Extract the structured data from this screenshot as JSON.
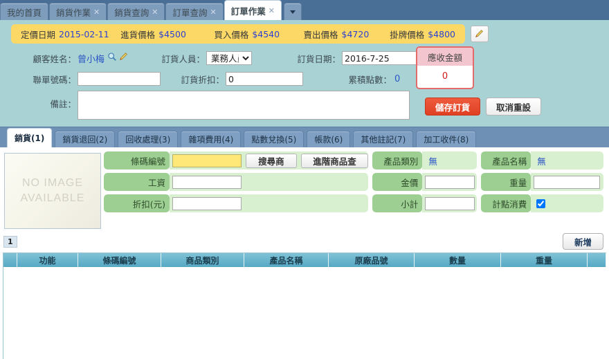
{
  "window_tabs": [
    {
      "label": "我的首頁",
      "closable": false,
      "active": false
    },
    {
      "label": "銷貨作業",
      "closable": true,
      "active": false
    },
    {
      "label": "銷貨查詢",
      "closable": true,
      "active": false
    },
    {
      "label": "訂單查詢",
      "closable": true,
      "active": false
    },
    {
      "label": "訂單作業",
      "closable": true,
      "active": true
    }
  ],
  "tab_overflow_icon": "chevron-down-icon",
  "price_bar": {
    "items": [
      {
        "label": "定價日期",
        "value": "2015-02-11"
      },
      {
        "label": "進貨價格",
        "value": "$4500"
      },
      {
        "label": "買入價格",
        "value": "$4540"
      },
      {
        "label": "賣出價格",
        "value": "$4720"
      },
      {
        "label": "掛牌價格",
        "value": "$4800"
      }
    ],
    "edit_icon": "pencil-icon"
  },
  "form": {
    "customer_label": "顧客姓名：",
    "customer_value": "曾小梅",
    "customer_search_icon": "magnifier-icon",
    "customer_edit_icon": "pencil-icon",
    "staff_label": "訂貨人員：",
    "staff_value": "業務人員",
    "staff_options": [
      "業務人員"
    ],
    "date_label": "訂貨日期：",
    "date_value": "2016-7-25",
    "order_no_label": "聯單號碼：",
    "order_no_value": "",
    "discount_label": "訂貨折扣：",
    "discount_value": "0",
    "points_label": "累積點數：",
    "points_value": "0",
    "remark_label": "備註：",
    "remark_value": "",
    "receivable_title": "應收金額",
    "receivable_value": "0",
    "save_label": "儲存訂貨",
    "cancel_label": "取消重設"
  },
  "section_tabs": [
    {
      "label": "銷貨(1)",
      "active": true
    },
    {
      "label": "銷貨退回(2)",
      "active": false
    },
    {
      "label": "回收處理(3)",
      "active": false
    },
    {
      "label": "雜項費用(4)",
      "active": false
    },
    {
      "label": "點數兌換(5)",
      "active": false
    },
    {
      "label": "帳款(6)",
      "active": false
    },
    {
      "label": "其他註記(7)",
      "active": false
    },
    {
      "label": "加工收件(8)",
      "active": false
    }
  ],
  "image_placeholder": {
    "line1": "NO IMAGE",
    "line2": "AVAILABLE"
  },
  "entry_panel": {
    "barcode_label": "條碼編號",
    "barcode_value": "",
    "search_product_label": "搜尋商品",
    "advanced_search_label": "進階商品查詢",
    "category_label": "產品類別",
    "category_value": "無",
    "product_name_label": "產品名稱",
    "product_name_value": "無",
    "wage_label": "工資",
    "wage_value": "",
    "gold_price_label": "金價",
    "gold_price_value": "",
    "weight_label": "重量",
    "weight_value": "",
    "discount_label": "折扣(元)",
    "discount_value": "",
    "subtotal_label": "小計",
    "subtotal_value": "",
    "points_consume_label": "計點消費",
    "points_consume_checked": true
  },
  "add_button_label": "新增",
  "page_index": "1",
  "table": {
    "columns": [
      "功能",
      "條碼編號",
      "商品類別",
      "產品名稱",
      "原廠品號",
      "數量",
      "重量"
    ],
    "rows": []
  },
  "colors": {
    "window_bg": "#a9d2d5",
    "tabstrip": "#4a6f96",
    "price_bar": "#fcd966",
    "accent_blue": "#2b55c4",
    "save_red": "#e03f22",
    "panel_green": "#c3e3b9",
    "table_header": "#56a9c4"
  }
}
